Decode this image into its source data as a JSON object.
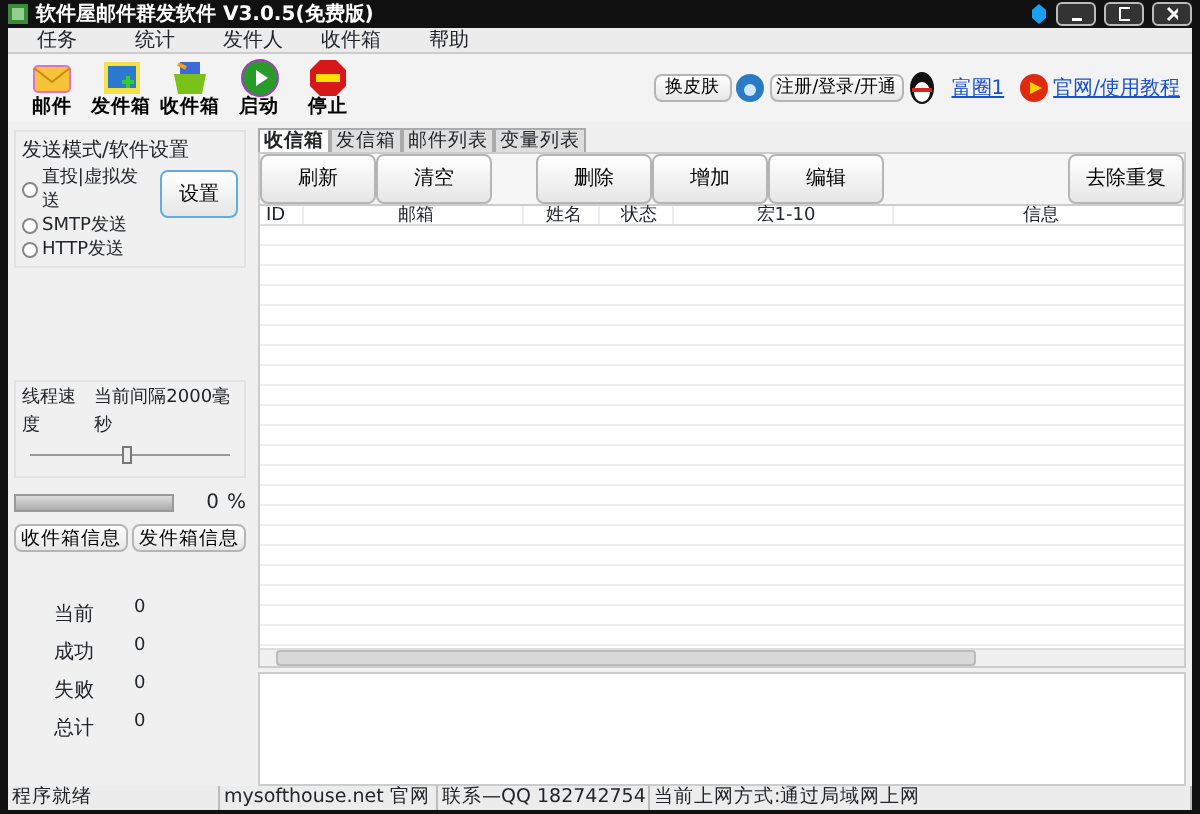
{
  "window": {
    "title": "软件屋邮件群发软件 V3.0.5(免费版)"
  },
  "menu": [
    "任务",
    "统计",
    "发件人",
    "收件箱",
    "帮助"
  ],
  "toolbar": [
    {
      "label": "邮件",
      "kind": "mail"
    },
    {
      "label": "发件箱",
      "kind": "outbox"
    },
    {
      "label": "收件箱",
      "kind": "inbox"
    },
    {
      "label": "启动",
      "kind": "start"
    },
    {
      "label": "停止",
      "kind": "stop"
    }
  ],
  "top_links": {
    "skin_button": "换皮肤",
    "register_button": "注册/登录/开通",
    "qq_link": "富圈1",
    "tutorial_link": "官网/使用教程"
  },
  "send_mode": {
    "title": "发送模式/软件设置",
    "options": [
      {
        "label": "直投|虚拟发送",
        "selected": false
      },
      {
        "label": "SMTP发送",
        "selected": false
      },
      {
        "label": "HTTP发送",
        "selected": false
      }
    ],
    "settings_button": "设置"
  },
  "thread_speed": {
    "label": "线程速度",
    "interval": "当前间隔2000毫秒",
    "level": 0.48
  },
  "progress": {
    "level": 0,
    "percent": "0",
    "unit": "%"
  },
  "info_buttons": [
    "收件箱信息",
    "发件箱信息"
  ],
  "stats": [
    {
      "label": "当前",
      "value": "0"
    },
    {
      "label": "成功",
      "value": "0"
    },
    {
      "label": "失败",
      "value": "0"
    },
    {
      "label": "总计",
      "value": "0"
    }
  ],
  "tabs": [
    {
      "label": "收信箱",
      "selected": true
    },
    {
      "label": "发信箱",
      "selected": false
    },
    {
      "label": "邮件列表",
      "selected": false
    },
    {
      "label": "变量列表",
      "selected": false
    }
  ],
  "actions": [
    "刷新",
    "清空",
    "删除",
    "增加",
    "编辑",
    "去除重复"
  ],
  "table": {
    "columns": [
      "ID",
      "邮箱",
      "姓名",
      "状态",
      "宏1-10",
      "信息"
    ]
  },
  "status_bar": [
    "程序就绪",
    "mysofthouse.net 官网",
    "联系—QQ 182742754",
    "当前上网方式:通过局域网上网"
  ]
}
